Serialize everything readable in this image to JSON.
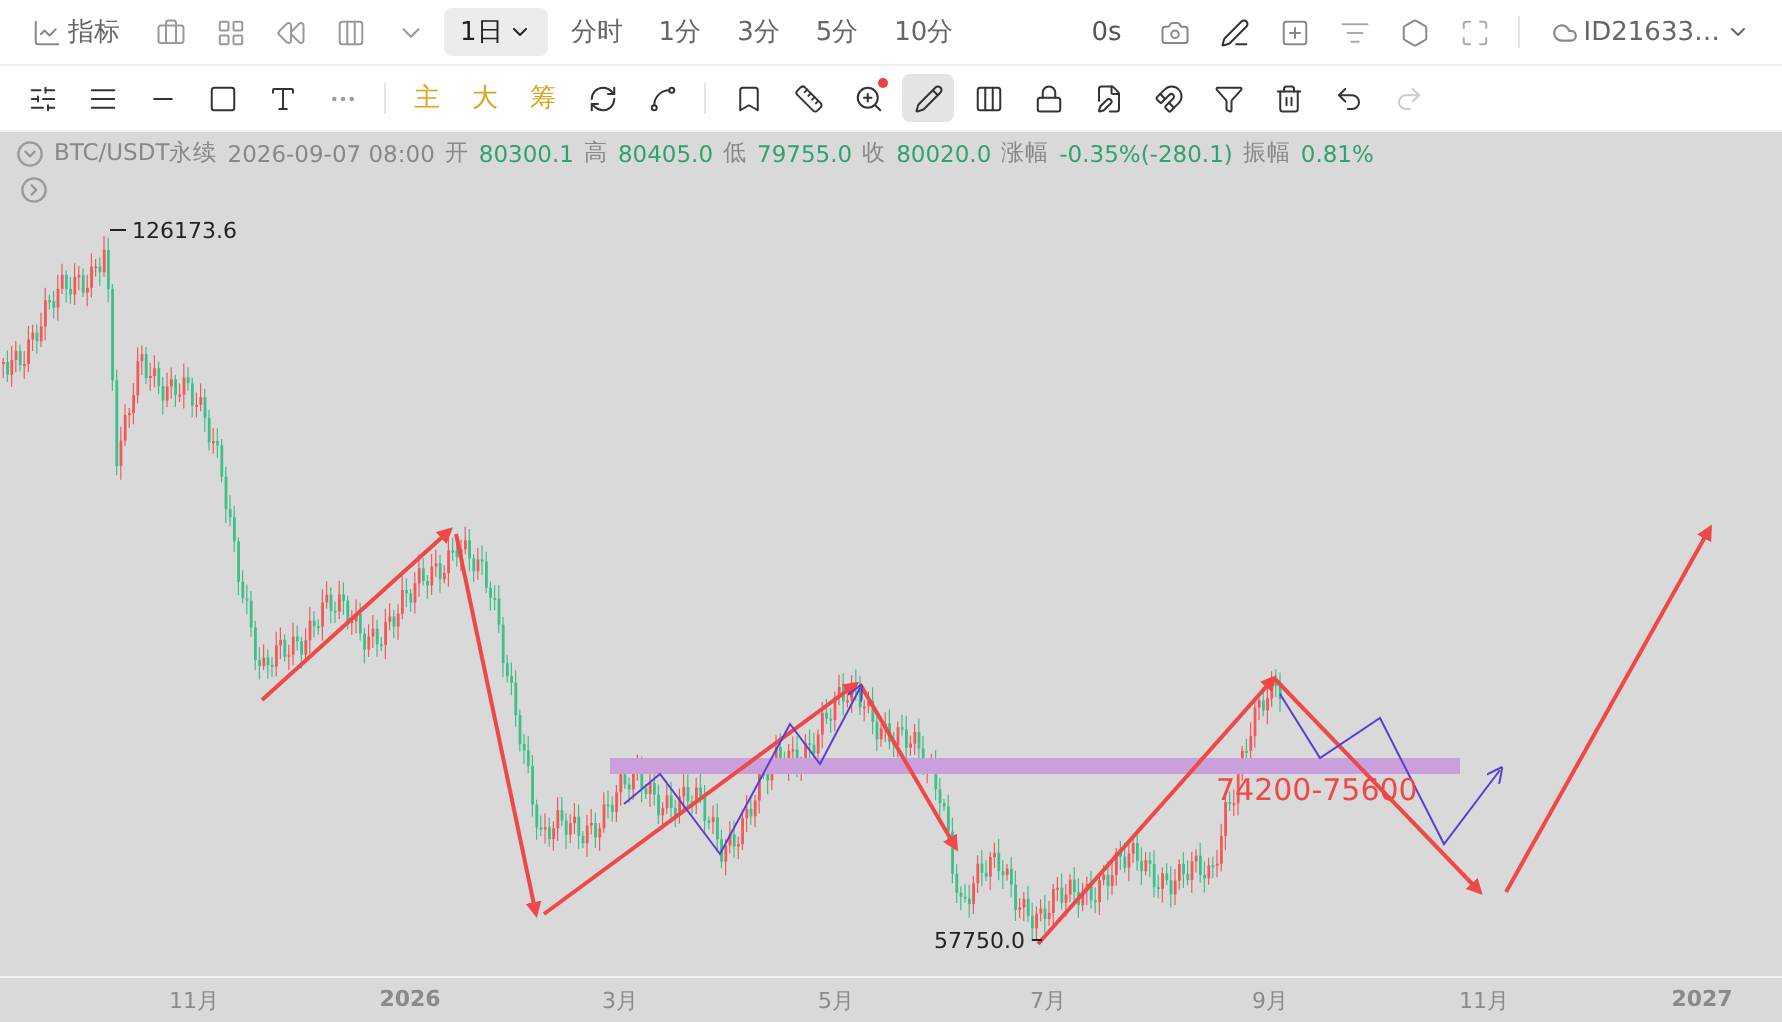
{
  "top_toolbar": {
    "indicator_label": "指标",
    "period": {
      "label": "1日",
      "selected": true
    },
    "intervals": [
      {
        "label": "分时",
        "selected": false
      },
      {
        "label": "1分",
        "selected": false
      },
      {
        "label": "3分",
        "selected": false
      },
      {
        "label": "5分",
        "selected": false
      },
      {
        "label": "10分",
        "selected": false
      }
    ],
    "countdown": "0s",
    "account": "ID21633…"
  },
  "drawing_toolbar": {
    "chips": [
      "主",
      "大",
      "筹"
    ],
    "pen_tool_active": true,
    "zoom_notification": true
  },
  "legend": {
    "symbol": "BTC/USDT永续",
    "time": "2026-09-07 08:00",
    "fields": [
      {
        "label": "开",
        "value": "80300.1"
      },
      {
        "label": "高",
        "value": "80405.0"
      },
      {
        "label": "低",
        "value": "79755.0"
      },
      {
        "label": "收",
        "value": "80020.0"
      },
      {
        "label": "涨幅",
        "value": "-0.35%(-280.1)"
      },
      {
        "label": "振幅",
        "value": "0.81%"
      }
    ]
  },
  "chart": {
    "high_label": "126173.6",
    "low_label": "57750.0",
    "zone_label": "74200-75600"
  },
  "x_axis": [
    {
      "label": "11月",
      "kind": "month"
    },
    {
      "label": "2026",
      "kind": "year"
    },
    {
      "label": "3月",
      "kind": "month"
    },
    {
      "label": "5月",
      "kind": "month"
    },
    {
      "label": "7月",
      "kind": "month"
    },
    {
      "label": "9月",
      "kind": "month"
    },
    {
      "label": "11月",
      "kind": "month"
    },
    {
      "label": "2027",
      "kind": "year"
    }
  ]
}
